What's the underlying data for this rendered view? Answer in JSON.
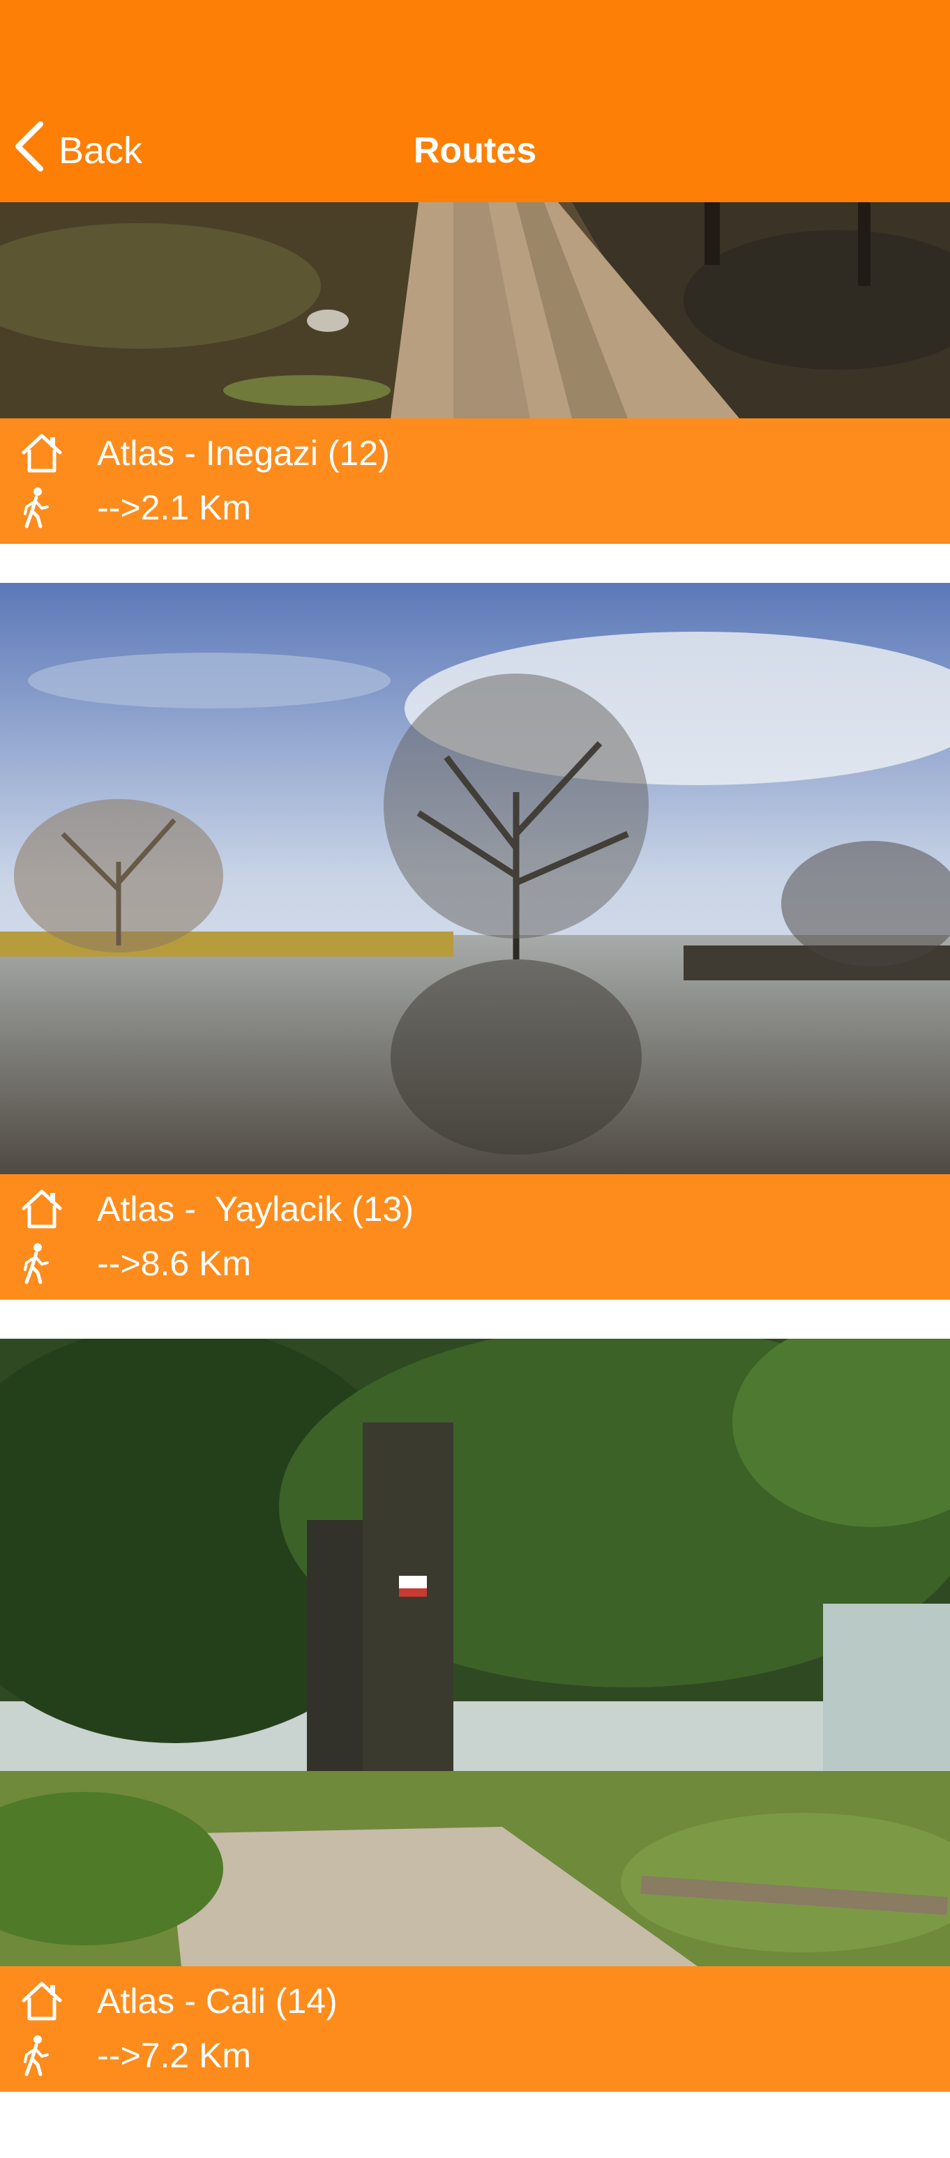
{
  "nav": {
    "back_label": "Back",
    "title": "Routes"
  },
  "routes": [
    {
      "name": "Atlas - Inegazi (12)",
      "arrow": "-->",
      "distance": "2.1 Km"
    },
    {
      "name": "Atlas -  Yaylacik (13)",
      "arrow": "-->",
      "distance": "8.6 Km"
    },
    {
      "name": "Atlas - Cali (14)",
      "arrow": "-->",
      "distance": "7.2 Km"
    }
  ],
  "colors": {
    "header": "#fd7f06",
    "card_bar": "#fd8c1c"
  },
  "icons": {
    "back": "chevron-left-icon",
    "route": "house-icon",
    "distance": "walking-person-icon"
  }
}
